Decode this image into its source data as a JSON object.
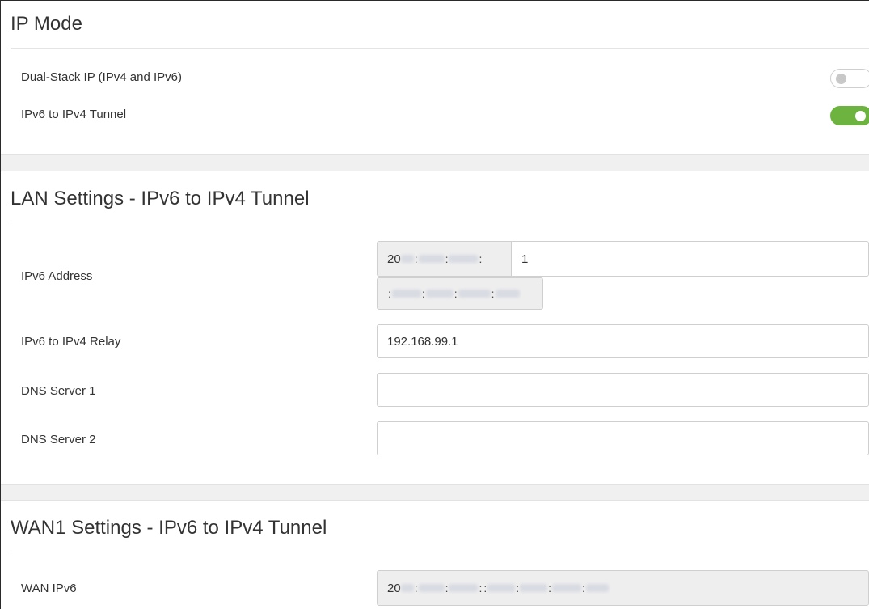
{
  "ip_mode": {
    "title": "IP Mode",
    "dual_stack": {
      "label": "Dual-Stack IP (IPv4 and IPv6)",
      "enabled": false
    },
    "tunnel": {
      "label": "IPv6 to IPv4 Tunnel",
      "enabled": true
    }
  },
  "lan": {
    "title": "LAN Settings - IPv6 to IPv4 Tunnel",
    "ipv6_address": {
      "label": "IPv6 Address",
      "prefix_start": "20",
      "prefix_sep": ":",
      "suffix_value": "1",
      "suffix_sep": ":"
    },
    "relay": {
      "label": "IPv6 to IPv4 Relay",
      "value": "192.168.99.1"
    },
    "dns1": {
      "label": "DNS Server 1",
      "value": ""
    },
    "dns2": {
      "label": "DNS Server 2",
      "value": ""
    }
  },
  "wan1": {
    "title": "WAN1 Settings - IPv6 to IPv4 Tunnel",
    "wan_ipv6": {
      "label": "WAN IPv6",
      "value_start": "20",
      "sep": ":"
    }
  },
  "colors": {
    "toggle_on": "#6cb33f",
    "readonly_bg": "#eeeeee",
    "section_gap_bg": "#f0f0f0"
  }
}
